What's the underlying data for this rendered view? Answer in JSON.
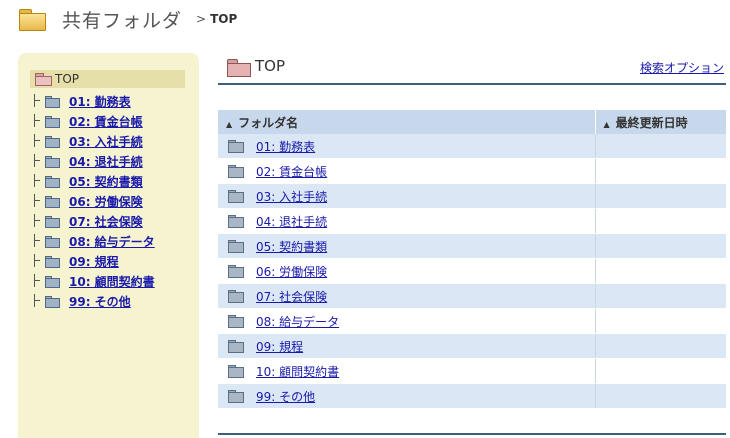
{
  "header": {
    "app_title": "共有フォルダ",
    "separator": ">",
    "breadcrumb": "TOP"
  },
  "sidebar": {
    "root_label": "TOP",
    "items": [
      {
        "label": "01: 勤務表"
      },
      {
        "label": "02: 賃金台帳"
      },
      {
        "label": "03: 入社手続"
      },
      {
        "label": "04: 退社手続"
      },
      {
        "label": "05: 契約書類"
      },
      {
        "label": "06: 労働保険"
      },
      {
        "label": "07: 社会保険"
      },
      {
        "label": "08: 給与データ"
      },
      {
        "label": "09: 規程"
      },
      {
        "label": "10: 顧問契約書"
      },
      {
        "label": "99: その他"
      }
    ]
  },
  "main": {
    "title": "TOP",
    "search_option": "検索オプション",
    "columns": {
      "name": "フォルダ名",
      "updated": "最終更新日時",
      "sort_arrow": "▲"
    },
    "rows": [
      {
        "name": "01: 勤務表",
        "updated": ""
      },
      {
        "name": "02: 賃金台帳",
        "updated": ""
      },
      {
        "name": "03: 入社手続",
        "updated": ""
      },
      {
        "name": "04: 退社手続",
        "updated": ""
      },
      {
        "name": "05: 契約書類",
        "updated": ""
      },
      {
        "name": "06: 労働保険",
        "updated": ""
      },
      {
        "name": "07: 社会保険",
        "updated": ""
      },
      {
        "name": "08: 給与データ",
        "updated": ""
      },
      {
        "name": "09: 規程",
        "updated": ""
      },
      {
        "name": "10: 顧問契約書",
        "updated": ""
      },
      {
        "name": "99: その他",
        "updated": ""
      }
    ]
  },
  "colors": {
    "link": "#1a1aaa",
    "sidebar_bg": "#f6f4d0",
    "header_row_bg": "#c7d8ec",
    "stripe_bg": "#dbe7f4",
    "rule": "#3f5e7c"
  },
  "icons": {
    "app": "folder-icon",
    "open_folder": "open-folder-icon",
    "row_folder": "folder-icon"
  }
}
